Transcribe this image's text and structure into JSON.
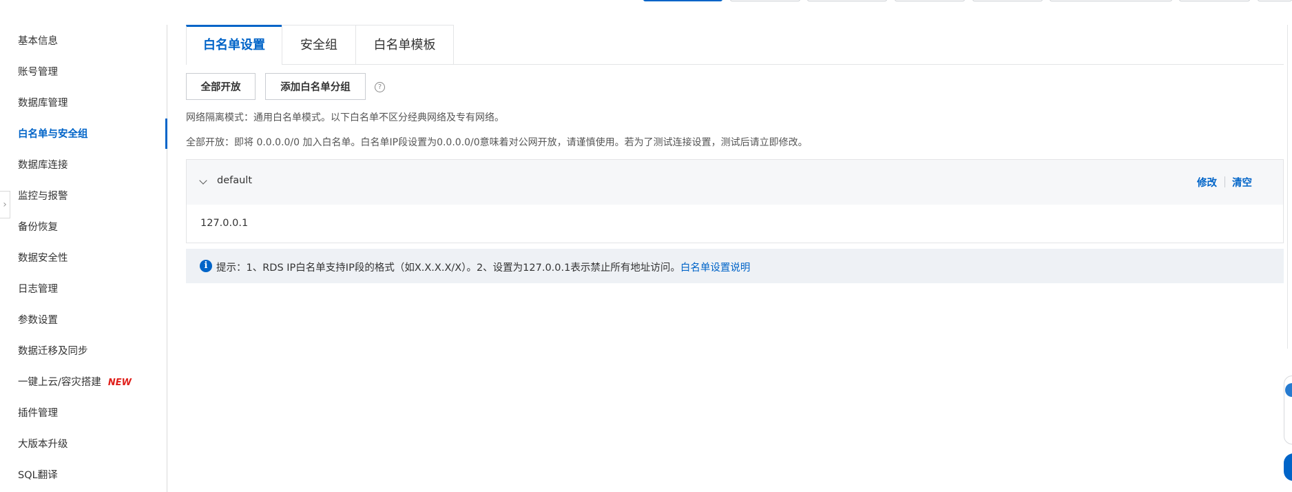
{
  "sidebar": {
    "items": [
      {
        "label": "基本信息"
      },
      {
        "label": "账号管理"
      },
      {
        "label": "数据库管理"
      },
      {
        "label": "白名单与安全组",
        "active": true
      },
      {
        "label": "数据库连接"
      },
      {
        "label": "监控与报警"
      },
      {
        "label": "备份恢复"
      },
      {
        "label": "数据安全性"
      },
      {
        "label": "日志管理"
      },
      {
        "label": "参数设置"
      },
      {
        "label": "数据迁移及同步"
      },
      {
        "label": "一键上云/容灾搭建",
        "badge": "NEW"
      },
      {
        "label": "插件管理"
      },
      {
        "label": "大版本升级"
      },
      {
        "label": "SQL翻译"
      }
    ]
  },
  "tabs": [
    {
      "label": "白名单设置",
      "active": true
    },
    {
      "label": "安全组"
    },
    {
      "label": "白名单模板"
    }
  ],
  "actions": {
    "open_all": "全部开放",
    "add_group": "添加白名单分组",
    "help_icon": "?"
  },
  "info": {
    "mode": "网络隔离模式：通用白名单模式。以下白名单不区分经典网络及专有网络。",
    "open_all_note": "全部开放：即将 0.0.0.0/0 加入白名单。白名单IP段设置为0.0.0.0/0意味着对公网开放，请谨慎使用。若为了测试连接设置，测试后请立即修改。"
  },
  "group": {
    "name": "default",
    "ips": "127.0.0.1",
    "edit": "修改",
    "clear": "清空"
  },
  "tip": {
    "icon": "i",
    "text": "提示：1、RDS IP白名单支持IP段的格式（如X.X.X.X/X）。2、设置为127.0.0.1表示禁止所有地址访问。",
    "link": "白名单设置说明"
  },
  "colors": {
    "accent": "#0064c8",
    "new_badge": "#e0201b",
    "tip_bg": "#eef1f5",
    "group_head_bg": "#f6f7f9"
  }
}
